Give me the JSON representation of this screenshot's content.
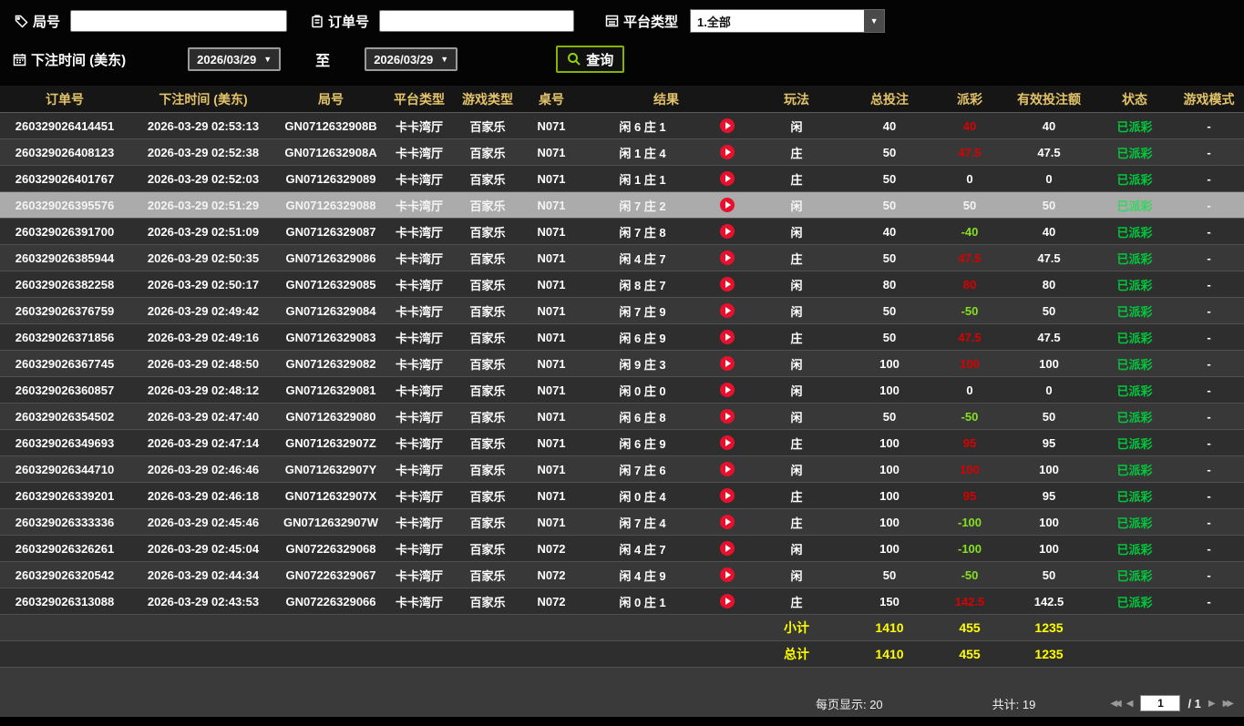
{
  "filters": {
    "round_label": "局号",
    "order_label": "订单号",
    "platform_label": "平台类型",
    "platform_value": "1.全部",
    "bet_time_label": "下注时间 (美东)",
    "date_from": "2026/03/29",
    "date_to": "2026/03/29",
    "to_label": "至",
    "search_label": "查询"
  },
  "table": {
    "headers": [
      "订单号",
      "下注时间 (美东)",
      "局号",
      "平台类型",
      "游戏类型",
      "桌号",
      "结果",
      "玩法",
      "总投注",
      "派彩",
      "有效投注额",
      "状态",
      "游戏模式"
    ],
    "rows": [
      {
        "order": "260329026414451",
        "time": "2026-03-29 02:53:13",
        "round": "GN0712632908B",
        "platform": "卡卡湾厅",
        "game": "百家乐",
        "table_no": "N071",
        "result": "闲 6 庄 1",
        "play": "闲",
        "total_bet": "40",
        "payout": "40",
        "valid_bet": "40",
        "status": "已派彩",
        "mode": "-"
      },
      {
        "order": "260329026408123",
        "time": "2026-03-29 02:52:38",
        "round": "GN0712632908A",
        "platform": "卡卡湾厅",
        "game": "百家乐",
        "table_no": "N071",
        "result": "闲 1 庄 4",
        "play": "庄",
        "total_bet": "50",
        "payout": "47.5",
        "valid_bet": "47.5",
        "status": "已派彩",
        "mode": "-"
      },
      {
        "order": "260329026401767",
        "time": "2026-03-29 02:52:03",
        "round": "GN07126329089",
        "platform": "卡卡湾厅",
        "game": "百家乐",
        "table_no": "N071",
        "result": "闲 1 庄 1",
        "play": "庄",
        "total_bet": "50",
        "payout": "0",
        "valid_bet": "0",
        "status": "已派彩",
        "mode": "-"
      },
      {
        "order": "260329026395576",
        "time": "2026-03-29 02:51:29",
        "round": "GN07126329088",
        "platform": "卡卡湾厅",
        "game": "百家乐",
        "table_no": "N071",
        "result": "闲 7 庄 2",
        "play": "闲",
        "total_bet": "50",
        "payout": "50",
        "valid_bet": "50",
        "status": "已派彩",
        "mode": "-",
        "selected": true
      },
      {
        "order": "260329026391700",
        "time": "2026-03-29 02:51:09",
        "round": "GN07126329087",
        "platform": "卡卡湾厅",
        "game": "百家乐",
        "table_no": "N071",
        "result": "闲 7 庄 8",
        "play": "闲",
        "total_bet": "40",
        "payout": "-40",
        "valid_bet": "40",
        "status": "已派彩",
        "mode": "-"
      },
      {
        "order": "260329026385944",
        "time": "2026-03-29 02:50:35",
        "round": "GN07126329086",
        "platform": "卡卡湾厅",
        "game": "百家乐",
        "table_no": "N071",
        "result": "闲 4 庄 7",
        "play": "庄",
        "total_bet": "50",
        "payout": "47.5",
        "valid_bet": "47.5",
        "status": "已派彩",
        "mode": "-"
      },
      {
        "order": "260329026382258",
        "time": "2026-03-29 02:50:17",
        "round": "GN07126329085",
        "platform": "卡卡湾厅",
        "game": "百家乐",
        "table_no": "N071",
        "result": "闲 8 庄 7",
        "play": "闲",
        "total_bet": "80",
        "payout": "80",
        "valid_bet": "80",
        "status": "已派彩",
        "mode": "-"
      },
      {
        "order": "260329026376759",
        "time": "2026-03-29 02:49:42",
        "round": "GN07126329084",
        "platform": "卡卡湾厅",
        "game": "百家乐",
        "table_no": "N071",
        "result": "闲 7 庄 9",
        "play": "闲",
        "total_bet": "50",
        "payout": "-50",
        "valid_bet": "50",
        "status": "已派彩",
        "mode": "-"
      },
      {
        "order": "260329026371856",
        "time": "2026-03-29 02:49:16",
        "round": "GN07126329083",
        "platform": "卡卡湾厅",
        "game": "百家乐",
        "table_no": "N071",
        "result": "闲 6 庄 9",
        "play": "庄",
        "total_bet": "50",
        "payout": "47.5",
        "valid_bet": "47.5",
        "status": "已派彩",
        "mode": "-"
      },
      {
        "order": "260329026367745",
        "time": "2026-03-29 02:48:50",
        "round": "GN07126329082",
        "platform": "卡卡湾厅",
        "game": "百家乐",
        "table_no": "N071",
        "result": "闲 9 庄 3",
        "play": "闲",
        "total_bet": "100",
        "payout": "100",
        "valid_bet": "100",
        "status": "已派彩",
        "mode": "-"
      },
      {
        "order": "260329026360857",
        "time": "2026-03-29 02:48:12",
        "round": "GN07126329081",
        "platform": "卡卡湾厅",
        "game": "百家乐",
        "table_no": "N071",
        "result": "闲 0 庄 0",
        "play": "闲",
        "total_bet": "100",
        "payout": "0",
        "valid_bet": "0",
        "status": "已派彩",
        "mode": "-"
      },
      {
        "order": "260329026354502",
        "time": "2026-03-29 02:47:40",
        "round": "GN07126329080",
        "platform": "卡卡湾厅",
        "game": "百家乐",
        "table_no": "N071",
        "result": "闲 6 庄 8",
        "play": "闲",
        "total_bet": "50",
        "payout": "-50",
        "valid_bet": "50",
        "status": "已派彩",
        "mode": "-"
      },
      {
        "order": "260329026349693",
        "time": "2026-03-29 02:47:14",
        "round": "GN0712632907Z",
        "platform": "卡卡湾厅",
        "game": "百家乐",
        "table_no": "N071",
        "result": "闲 6 庄 9",
        "play": "庄",
        "total_bet": "100",
        "payout": "95",
        "valid_bet": "95",
        "status": "已派彩",
        "mode": "-"
      },
      {
        "order": "260329026344710",
        "time": "2026-03-29 02:46:46",
        "round": "GN0712632907Y",
        "platform": "卡卡湾厅",
        "game": "百家乐",
        "table_no": "N071",
        "result": "闲 7 庄 6",
        "play": "闲",
        "total_bet": "100",
        "payout": "100",
        "valid_bet": "100",
        "status": "已派彩",
        "mode": "-"
      },
      {
        "order": "260329026339201",
        "time": "2026-03-29 02:46:18",
        "round": "GN0712632907X",
        "platform": "卡卡湾厅",
        "game": "百家乐",
        "table_no": "N071",
        "result": "闲 0 庄 4",
        "play": "庄",
        "total_bet": "100",
        "payout": "95",
        "valid_bet": "95",
        "status": "已派彩",
        "mode": "-"
      },
      {
        "order": "260329026333336",
        "time": "2026-03-29 02:45:46",
        "round": "GN0712632907W",
        "platform": "卡卡湾厅",
        "game": "百家乐",
        "table_no": "N071",
        "result": "闲 7 庄 4",
        "play": "庄",
        "total_bet": "100",
        "payout": "-100",
        "valid_bet": "100",
        "status": "已派彩",
        "mode": "-"
      },
      {
        "order": "260329026326261",
        "time": "2026-03-29 02:45:04",
        "round": "GN07226329068",
        "platform": "卡卡湾厅",
        "game": "百家乐",
        "table_no": "N072",
        "result": "闲 4 庄 7",
        "play": "闲",
        "total_bet": "100",
        "payout": "-100",
        "valid_bet": "100",
        "status": "已派彩",
        "mode": "-"
      },
      {
        "order": "260329026320542",
        "time": "2026-03-29 02:44:34",
        "round": "GN07226329067",
        "platform": "卡卡湾厅",
        "game": "百家乐",
        "table_no": "N072",
        "result": "闲 4 庄 9",
        "play": "闲",
        "total_bet": "50",
        "payout": "-50",
        "valid_bet": "50",
        "status": "已派彩",
        "mode": "-"
      },
      {
        "order": "260329026313088",
        "time": "2026-03-29 02:43:53",
        "round": "GN07226329066",
        "platform": "卡卡湾厅",
        "game": "百家乐",
        "table_no": "N072",
        "result": "闲 0 庄 1",
        "play": "庄",
        "total_bet": "150",
        "payout": "142.5",
        "valid_bet": "142.5",
        "status": "已派彩",
        "mode": "-"
      }
    ],
    "subtotal": {
      "label": "小计",
      "total_bet": "1410",
      "payout": "455",
      "valid_bet": "1235"
    },
    "total": {
      "label": "总计",
      "total_bet": "1410",
      "payout": "455",
      "valid_bet": "1235"
    }
  },
  "footer": {
    "per_page": "每页显示: 20",
    "total_count": "共计: 19",
    "page": "1",
    "page_total": "/ 1"
  }
}
